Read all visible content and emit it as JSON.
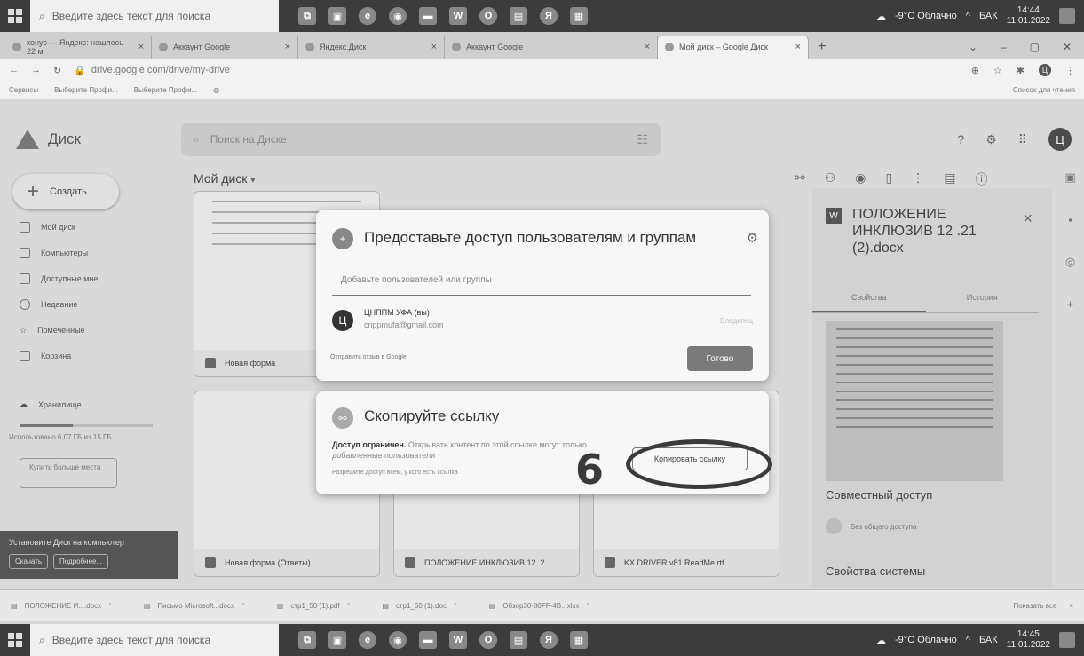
{
  "taskbar": {
    "search_placeholder": "Введите здесь текст для поиска",
    "weather": "-9°C Облачно",
    "lang": "БАК",
    "top_time": "14:44",
    "bottom_time": "14:45",
    "date": "11.01.2022"
  },
  "tabs": [
    {
      "label": "конус — Яндекс: нашлось 22 м"
    },
    {
      "label": "Аккаунт Google"
    },
    {
      "label": "Яндекс.Диск"
    },
    {
      "label": "Аккаунт Google"
    },
    {
      "label": "Мой диск – Google Диск"
    }
  ],
  "address": {
    "url": "drive.google.com/drive/my-drive"
  },
  "bookmarks": {
    "items": [
      "Сервисы",
      "Выберите Профи...",
      "Выберите Профи..."
    ],
    "reading_list": "Список для чтения"
  },
  "drive": {
    "logo_text": "Диск",
    "search_placeholder": "Поиск на Диске",
    "avatar_letter": "Ц",
    "create_label": "Создать",
    "mydisk_title": "Мой диск",
    "nav": [
      {
        "label": "Мой диск"
      },
      {
        "label": "Компьютеры"
      },
      {
        "label": "Доступные мне"
      },
      {
        "label": "Недавние"
      },
      {
        "label": "Помеченные"
      },
      {
        "label": "Корзина"
      }
    ],
    "storage_label": "Хранилище",
    "storage_used_text": "Использовано 6,07 ГБ из 15 ГБ",
    "storage_fraction": 0.4,
    "buy_more": "Купить больше места",
    "install_banner": {
      "text": "Установите Диск на компьютер",
      "download": "Скачать",
      "details": "Подробнее..."
    },
    "files": [
      {
        "name": "Новая форма"
      },
      {
        "name": "Новая форма (Ответы)"
      },
      {
        "name": "ПОЛОЖЕНИЕ ИНКЛЮЗИВ 12 .2..."
      },
      {
        "name": "KX DRIVER v81 ReadMe.rtf"
      }
    ]
  },
  "details": {
    "file_title": "ПОЛОЖЕНИЕ ИНКЛЮЗИВ 12 .21 (2).docx",
    "tab_properties": "Свойства",
    "tab_history": "История",
    "shared_access": "Совместный доступ",
    "no_shared": "Без общего доступа",
    "system_props": "Свойства системы"
  },
  "share_dialog": {
    "title": "Предоставьте доступ пользователям и группам",
    "add_placeholder": "Добавьте пользователей или группы",
    "user_avatar": "Ц",
    "user_name": "ЦНППМ УФА (вы)",
    "user_email": "cnppmufa@gmail.com",
    "user_role": "Владелец",
    "feedback": "Отправить отзыв в Google",
    "done": "Готово"
  },
  "link_dialog": {
    "title": "Скопируйте ссылку",
    "access_bold": "Доступ ограничен.",
    "access_text": "Открывать контент по этой ссылке могут только добавленные пользователи",
    "allow_all": "Разрешите доступ всем, у кого есть ссылка",
    "copy_button": "Копировать ссылку",
    "annotation_digit": "6"
  },
  "downloads": {
    "files": [
      "ПОЛОЖЕНИЕ И....docx",
      "Письмо Microsoft...docx",
      "стр1_50 (1).pdf",
      "стр1_50 (1).doc",
      "Обзор30-80FF-4B...xlsx"
    ],
    "show_all": "Показать все"
  }
}
